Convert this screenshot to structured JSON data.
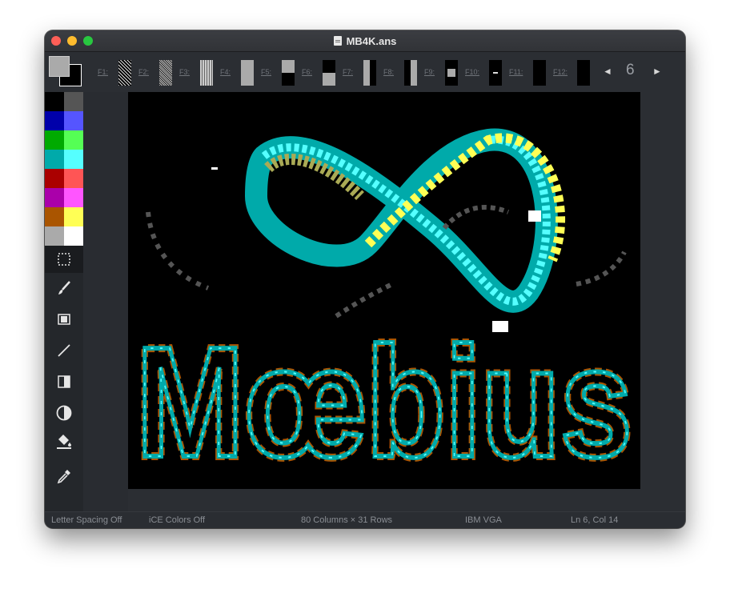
{
  "window": {
    "title": "MB4K.ans"
  },
  "toolbar": {
    "fkeys": [
      {
        "label": "F1:",
        "glyph": "shade-light"
      },
      {
        "label": "F2:",
        "glyph": "shade-medium"
      },
      {
        "label": "F3:",
        "glyph": "shade-dark"
      },
      {
        "label": "F4:",
        "glyph": "full-block"
      },
      {
        "label": "F5:",
        "glyph": "upper-half-block"
      },
      {
        "label": "F6:",
        "glyph": "lower-half-block"
      },
      {
        "label": "F7:",
        "glyph": "left-half-block"
      },
      {
        "label": "F8:",
        "glyph": "right-half-block"
      },
      {
        "label": "F9:",
        "glyph": "middle-square"
      },
      {
        "label": "F10:",
        "glyph": "small-dash"
      },
      {
        "label": "F11:",
        "glyph": "empty"
      },
      {
        "label": "F12:",
        "glyph": "empty"
      }
    ],
    "prev_icon": "◄",
    "next_icon": "►",
    "charset_number": "6"
  },
  "colors": {
    "foreground": "#aaaaaa",
    "background": "#000000",
    "palette": [
      "#000000",
      "#555555",
      "#0000aa",
      "#5555ff",
      "#00aa00",
      "#55ff55",
      "#00aaaa",
      "#55ffff",
      "#aa0000",
      "#ff5555",
      "#aa00aa",
      "#ff55ff",
      "#aa5500",
      "#ffff55",
      "#aaaaaa",
      "#ffffff"
    ]
  },
  "tools": [
    {
      "name": "selection-tool",
      "icon": "dotted-rectangle-icon"
    },
    {
      "name": "brush-tool",
      "icon": "brush-icon"
    },
    {
      "name": "shading-tool",
      "icon": "shading-block-icon"
    },
    {
      "name": "line-tool",
      "icon": "line-icon"
    },
    {
      "name": "half-block-tool",
      "icon": "half-block-icon"
    },
    {
      "name": "contrast-tool",
      "icon": "contrast-icon"
    },
    {
      "name": "fill-tool",
      "icon": "paint-bucket-icon"
    },
    {
      "name": "eyedropper-tool",
      "icon": "eyedropper-icon"
    }
  ],
  "canvas": {
    "artwork": "Moebius ANSI art logo"
  },
  "status": {
    "letter_spacing": "Letter Spacing Off",
    "ice_colors": "iCE Colors Off",
    "dimensions": "80 Columns × 31 Rows",
    "font": "IBM VGA",
    "cursor": "Ln 6, Col 14"
  }
}
